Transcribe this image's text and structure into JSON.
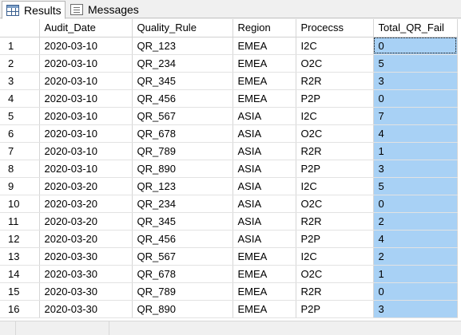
{
  "tabs": {
    "results": {
      "label": "Results",
      "icon": "grid-icon"
    },
    "messages": {
      "label": "Messages",
      "icon": "messages-icon"
    }
  },
  "grid": {
    "columns": [
      "",
      "Audit_Date",
      "Quality_Rule",
      "Region",
      "Procecss",
      "Total_QR_Fail"
    ],
    "rows": [
      [
        "1",
        "2020-03-10",
        "QR_123",
        "EMEA",
        "I2C",
        "0"
      ],
      [
        "2",
        "2020-03-10",
        "QR_234",
        "EMEA",
        "O2C",
        "5"
      ],
      [
        "3",
        "2020-03-10",
        "QR_345",
        "EMEA",
        "R2R",
        "3"
      ],
      [
        "4",
        "2020-03-10",
        "QR_456",
        "EMEA",
        "P2P",
        "0"
      ],
      [
        "5",
        "2020-03-10",
        "QR_567",
        "ASIA",
        "I2C",
        "7"
      ],
      [
        "6",
        "2020-03-10",
        "QR_678",
        "ASIA",
        "O2C",
        "4"
      ],
      [
        "7",
        "2020-03-10",
        "QR_789",
        "ASIA",
        "R2R",
        "1"
      ],
      [
        "8",
        "2020-03-10",
        "QR_890",
        "ASIA",
        "P2P",
        "3"
      ],
      [
        "9",
        "2020-03-20",
        "QR_123",
        "ASIA",
        "I2C",
        "5"
      ],
      [
        "10",
        "2020-03-20",
        "QR_234",
        "ASIA",
        "O2C",
        "0"
      ],
      [
        "11",
        "2020-03-20",
        "QR_345",
        "ASIA",
        "R2R",
        "2"
      ],
      [
        "12",
        "2020-03-20",
        "QR_456",
        "ASIA",
        "P2P",
        "4"
      ],
      [
        "13",
        "2020-03-30",
        "QR_567",
        "EMEA",
        "I2C",
        "2"
      ],
      [
        "14",
        "2020-03-30",
        "QR_678",
        "EMEA",
        "O2C",
        "1"
      ],
      [
        "15",
        "2020-03-30",
        "QR_789",
        "EMEA",
        "R2R",
        "0"
      ],
      [
        "16",
        "2020-03-30",
        "QR_890",
        "EMEA",
        "P2P",
        "3"
      ]
    ],
    "selected_column": "Total_QR_Fail",
    "selection_color": "#a8d1f5"
  }
}
